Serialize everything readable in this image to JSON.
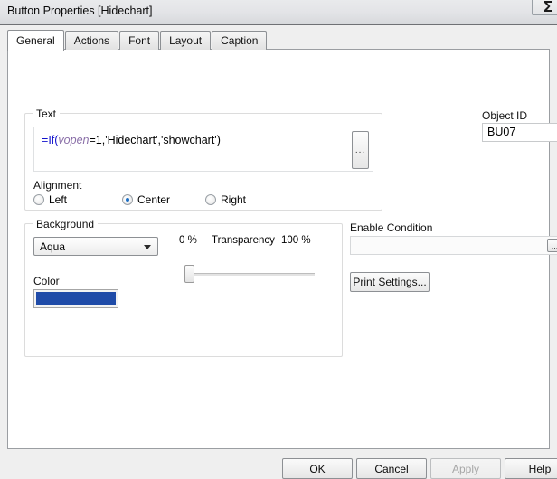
{
  "window": {
    "title": "Button Properties [Hidechart]",
    "control_button_icon": "sigma-icon"
  },
  "tabs": [
    {
      "label": "General",
      "active": true
    },
    {
      "label": "Actions",
      "active": false
    },
    {
      "label": "Font",
      "active": false
    },
    {
      "label": "Layout",
      "active": false
    },
    {
      "label": "Caption",
      "active": false
    }
  ],
  "text_group": {
    "title": "Text",
    "formula": {
      "full": "=If(vopen=1,'Hidechart','showchart')",
      "part_eq": "=",
      "part_fn": "If(",
      "part_var": "vopen",
      "part_rest": "=1,'Hidechart','showchart')"
    },
    "ellipsis_label": "...",
    "alignment_label": "Alignment",
    "alignment_options": [
      {
        "label": "Left",
        "selected": false
      },
      {
        "label": "Center",
        "selected": true
      },
      {
        "label": "Right",
        "selected": false
      }
    ]
  },
  "background_group": {
    "title": "Background",
    "style_value": "Aqua",
    "color_label": "Color",
    "color_value": "#1f4ba8",
    "transparency": {
      "min_label": "0 %",
      "label": "Transparency",
      "max_label": "100 %",
      "value": 0
    }
  },
  "right_panel": {
    "object_id_label": "Object ID",
    "object_id_value": "BU07",
    "enable_condition_label": "Enable Condition",
    "enable_condition_value": "",
    "enable_ellipsis_label": "...",
    "print_settings_label": "Print Settings..."
  },
  "footer": {
    "ok": "OK",
    "cancel": "Cancel",
    "apply": "Apply",
    "help": "Help"
  }
}
